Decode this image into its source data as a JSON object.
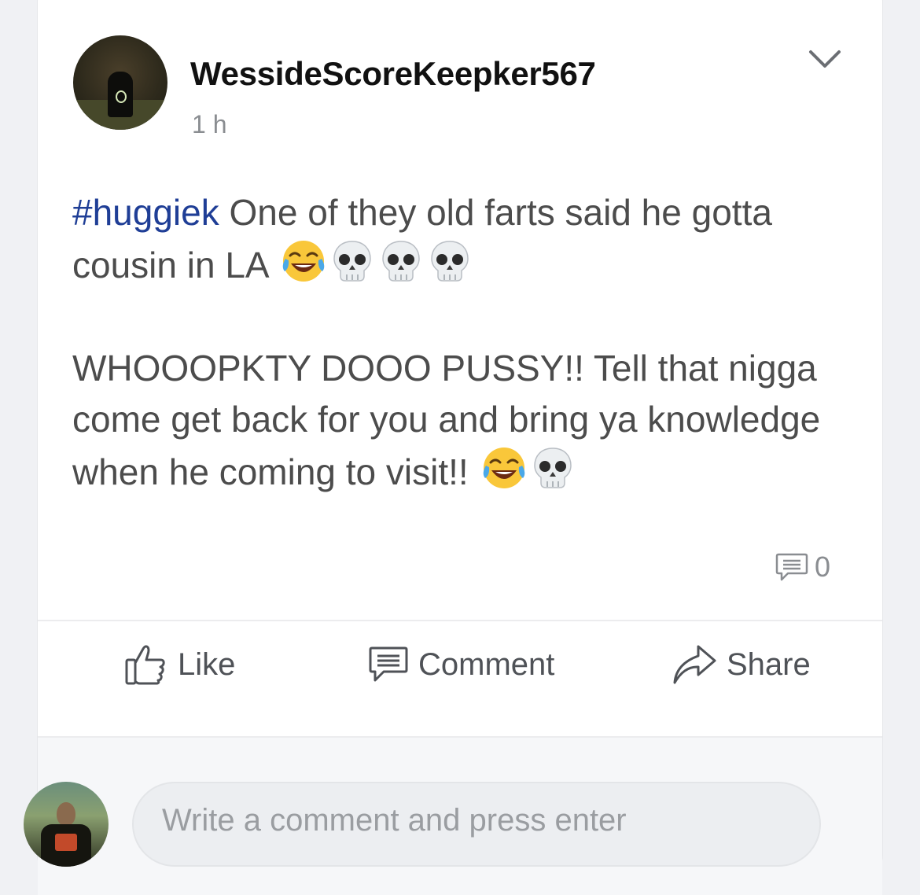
{
  "post": {
    "author": "WessideScoreKeepker567",
    "time": "1 h",
    "hashtag": "#huggiek",
    "line1_text": " One of they old farts said he gotta cousin in LA ",
    "paragraph2_text": "WHOOOPKTY DOOO PUSSY!! Tell that nigga come get back for you and bring ya knowledge when he coming to visit!! ",
    "comment_count": "0"
  },
  "actions": {
    "like_label": "Like",
    "comment_label": "Comment",
    "share_label": "Share"
  },
  "composer": {
    "placeholder": "Write a comment and press enter"
  },
  "icons": {
    "author_avatar": "avatar-image",
    "options": "chevron-down-icon",
    "emoji_laugh": "face-with-tears-of-joy-icon",
    "emoji_skull": "skull-icon",
    "comment_count": "comment-bubble-icon",
    "like": "thumbs-up-icon",
    "comment": "comment-bubble-icon",
    "share": "share-arrow-icon"
  },
  "colors": {
    "hashtag": "#1f3e96",
    "text": "#4c4c4c",
    "muted": "#8a8d91"
  }
}
